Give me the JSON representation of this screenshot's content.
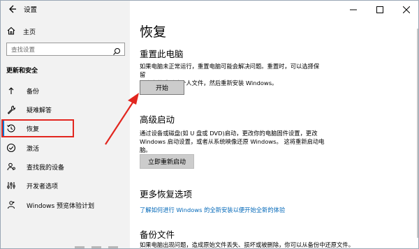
{
  "window": {
    "title": "设置"
  },
  "sidebar": {
    "home_label": "主页",
    "search_placeholder": "查找设置",
    "section_title": "更新和安全",
    "items": [
      {
        "label": "备份",
        "icon": "backup-arrow-icon"
      },
      {
        "label": "疑难解答",
        "icon": "wrench-icon"
      },
      {
        "label": "恢复",
        "icon": "history-icon"
      },
      {
        "label": "激活",
        "icon": "check-circle-icon"
      },
      {
        "label": "查找我的设备",
        "icon": "person-pin-icon"
      },
      {
        "label": "开发者选项",
        "icon": "settings-sliders-icon"
      },
      {
        "label": "Windows 预览体验计划",
        "icon": "insider-icon"
      }
    ],
    "active_index": 2
  },
  "main": {
    "page_title": "恢复",
    "reset": {
      "heading": "重置此电脑",
      "line1": "如果电脑未正常运行，重置电脑可能会解决问题。重置时，可以选择保留",
      "line2": "个人文件或删除个人文件，然后重新安装 Windows。",
      "button": "开始"
    },
    "advanced": {
      "heading": "高级启动",
      "line1": "通过设备或磁盘(如 U 盘或 DVD)启动，更改你的电脑固件设置，更改",
      "line2": "Windows 启动设置，或者从系统映像还原 Windows。 这将重新启动电脑。",
      "button": "立即重新启动"
    },
    "more": {
      "heading": "更多恢复选项",
      "link": "了解如何进行 Windows 的全新安装以便开始全新的体验"
    },
    "backup": {
      "heading": "备份文件",
      "line1": "如果电脑出现问题，造成原始文件丢失、损坏或被删除，你可以从备份中还原文件。"
    }
  },
  "colors": {
    "accent": "#0078d7",
    "highlight": "#e2261f",
    "arrow": "#e2261f",
    "link": "#0067b8"
  }
}
